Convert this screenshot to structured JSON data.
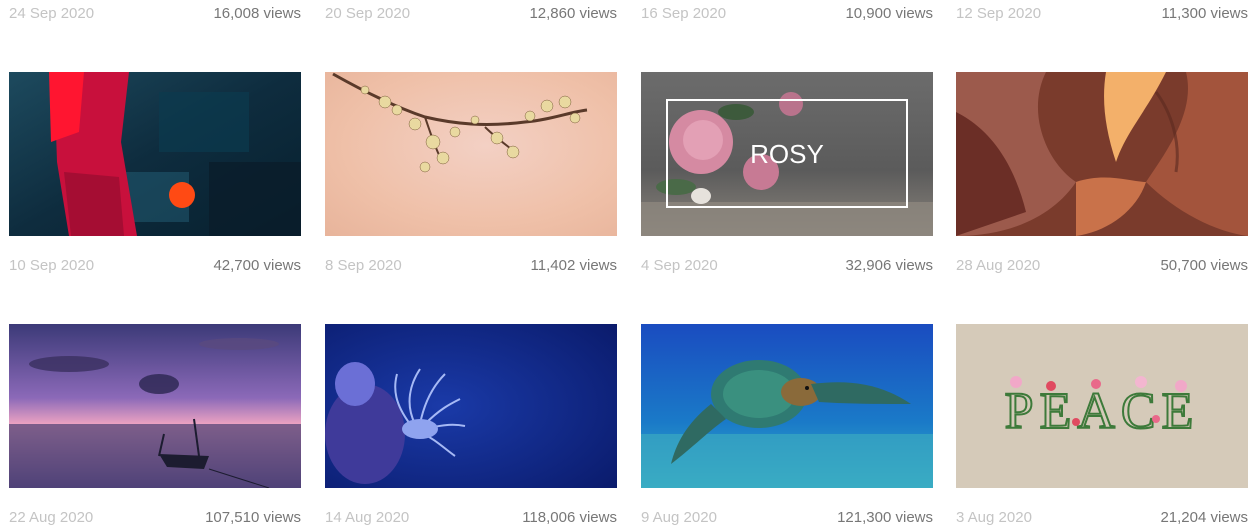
{
  "top_row": [
    {
      "date": "24 Sep 2020",
      "views": "16,008 views"
    },
    {
      "date": "20 Sep 2020",
      "views": "12,860 views"
    },
    {
      "date": "16 Sep 2020",
      "views": "10,900 views"
    },
    {
      "date": "12 Sep 2020",
      "views": "11,300 views"
    }
  ],
  "row_a": [
    {
      "date": "10 Sep 2020",
      "views": "42,700 views",
      "image": "abstract-paint-image"
    },
    {
      "date": "8 Sep 2020",
      "views": "11,402 views",
      "image": "cherry-blossom-image"
    },
    {
      "date": "4 Sep 2020",
      "views": "32,906 views",
      "image": "rosy-image",
      "overlay_text": "ROSY"
    },
    {
      "date": "28 Aug 2020",
      "views": "50,700 views",
      "image": "sandstone-canyon-image"
    }
  ],
  "row_b": [
    {
      "date": "22 Aug 2020",
      "views": "107,510 views",
      "image": "sunset-boat-image"
    },
    {
      "date": "14 Aug 2020",
      "views": "118,006 views",
      "image": "sea-anemone-image"
    },
    {
      "date": "9 Aug 2020",
      "views": "121,300 views",
      "image": "sea-turtle-image"
    },
    {
      "date": "3 Aug 2020",
      "views": "21,204 views",
      "image": "peace-flowers-image",
      "overlay_text": "PEACE"
    }
  ],
  "colors": {
    "date_text": "#c4c4c4",
    "views_text": "#777777"
  }
}
